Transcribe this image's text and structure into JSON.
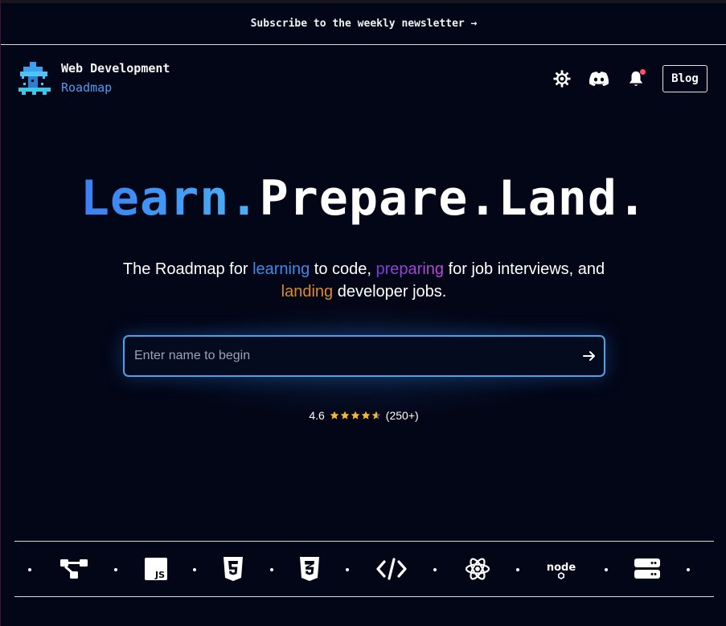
{
  "newsletter": {
    "text": "Subscribe to the weekly newsletter →"
  },
  "brand": {
    "title": "Web Development",
    "subtitle": "Roadmap"
  },
  "header": {
    "icons": [
      "settings-icon",
      "discord-icon",
      "bell-icon"
    ],
    "blog_label": "Blog"
  },
  "hero": {
    "title_learn": "Learn.",
    "title_rest": "Prepare.Land.",
    "tagline": {
      "part1": "The Roadmap for ",
      "learning": "learning",
      "part2": " to code, ",
      "preparing": "preparing",
      "part3": " for job interviews, and ",
      "landing": "landing",
      "part4": " developer jobs."
    }
  },
  "search": {
    "placeholder": "Enter name to begin",
    "value": ""
  },
  "rating": {
    "score": "4.6",
    "stars": 4.6,
    "count": "(250+)"
  },
  "tech_icons": [
    "roadmap-graph-icon",
    "javascript-icon",
    "html5-icon",
    "css3-icon",
    "code-icon",
    "react-icon",
    "nodejs-icon",
    "server-icon"
  ],
  "colors": {
    "background": "#030617",
    "learn_gradient": [
      "#3c7ef2",
      "#4bb3f4"
    ],
    "learning": "#3d8ae8",
    "preparing": "#9b45d6",
    "landing": "#dc8a2c",
    "search_border": "#4aa3ea",
    "star": "#f5b82e",
    "notification": "#ff4f6b"
  }
}
